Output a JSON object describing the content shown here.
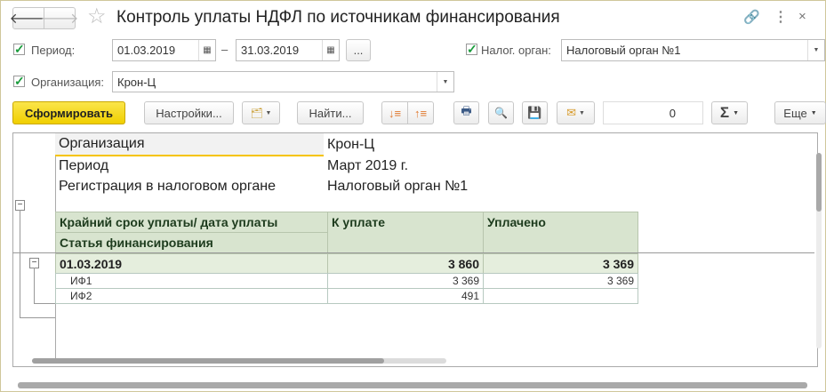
{
  "title": "Контроль уплаты НДФЛ по источникам финансирования",
  "filters": {
    "period_label": "Период:",
    "date_from": "01.03.2019",
    "dash": "–",
    "date_to": "31.03.2019",
    "ellipsis": "...",
    "tax_label": "Налог. орган:",
    "tax_value": "Налоговый орган №1",
    "org_label": "Организация:",
    "org_value": "Крон-Ц"
  },
  "toolbar": {
    "generate": "Сформировать",
    "settings": "Настройки...",
    "find": "Найти...",
    "sum_value": "0",
    "sigma": "Σ",
    "more": "Еще"
  },
  "report": {
    "header": [
      {
        "label": "Организация",
        "value": "Крон-Ц"
      },
      {
        "label": "Период",
        "value": "Март 2019 г."
      },
      {
        "label": "Регистрация в налоговом органе",
        "value": "Налоговый орган №1"
      }
    ],
    "columns": {
      "col1": "Крайний срок уплаты/ дата уплаты",
      "col1_sub": "Статья финансирования",
      "col2": "К уплате",
      "col3": "Уплачено"
    },
    "group": {
      "date": "01.03.2019",
      "due": "3 860",
      "paid": "3 369"
    },
    "rows": [
      {
        "name": "ИФ1",
        "due": "3 369",
        "paid": "3 369"
      },
      {
        "name": "ИФ2",
        "due": "491",
        "paid": ""
      }
    ]
  }
}
